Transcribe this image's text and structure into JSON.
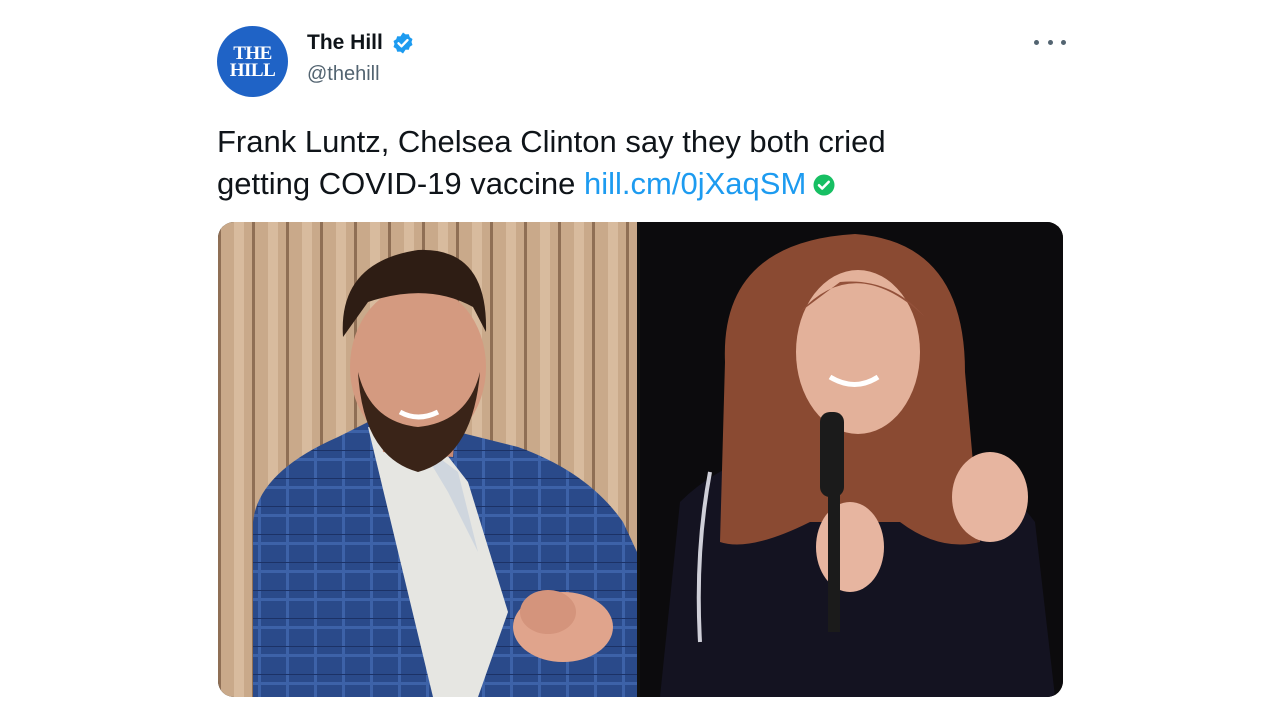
{
  "tweet": {
    "avatar_text_top": "THE",
    "avatar_text_bottom": "HILL",
    "display_name": "The Hill",
    "handle": "@thehill",
    "text": "Frank Luntz, Chelsea Clinton say they both cried",
    "text_line2": "getting COVID-19 vaccine",
    "link": "hill.cm/0jXaqSM"
  },
  "icons": {
    "verified": "verified-badge-icon",
    "more": "more-horizontal-icon",
    "link_check": "check-circle-icon"
  },
  "media": {
    "photo_left": "photo-frank-luntz",
    "photo_right": "photo-chelsea-clinton"
  },
  "colors": {
    "link": "#1d9bf0",
    "verified": "#1d9bf0",
    "check": "#17bf63",
    "avatar_bg": "#1f63c6"
  }
}
